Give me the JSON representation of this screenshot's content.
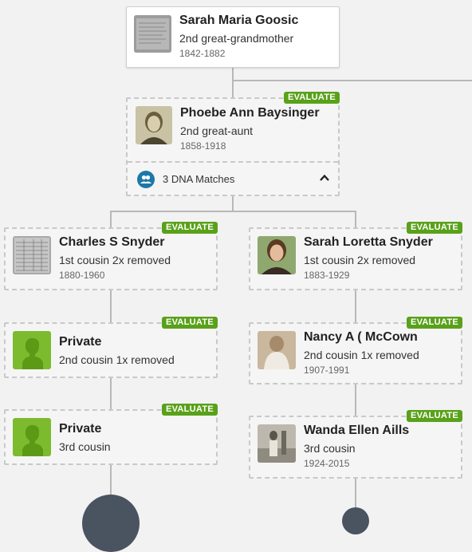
{
  "badge_label": "EVALUATE",
  "cards": {
    "sarah_maria": {
      "name": "Sarah Maria Goosic",
      "relationship": "2nd great-grandmother",
      "years": "1842-1882"
    },
    "phoebe": {
      "name": "Phoebe Ann Baysinger",
      "relationship": "2nd great-aunt",
      "years": "1858-1918",
      "dna_matches": "3 DNA Matches"
    },
    "charles": {
      "name": "Charles S Snyder",
      "relationship": "1st cousin 2x removed",
      "years": "1880-1960"
    },
    "sarah_loretta": {
      "name": "Sarah Loretta Snyder",
      "relationship": "1st cousin 2x removed",
      "years": "1883-1929"
    },
    "private1": {
      "name": "Private",
      "relationship": "2nd cousin 1x removed"
    },
    "nancy": {
      "name": "Nancy A ( McCown",
      "relationship": "2nd cousin 1x removed",
      "years": "1907-1991"
    },
    "private2": {
      "name": "Private",
      "relationship": "3rd cousin"
    },
    "wanda": {
      "name": "Wanda Ellen Aills",
      "relationship": "3rd cousin",
      "years": "1924-2015"
    }
  },
  "colors": {
    "accent_green": "#5aa11a",
    "dna_blue": "#1c78a8",
    "line_gray": "#b8b8b8"
  }
}
